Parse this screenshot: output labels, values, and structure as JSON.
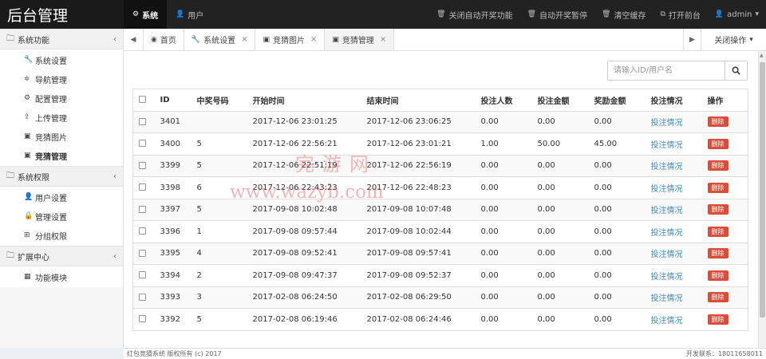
{
  "brand": "后台管理",
  "topnav": {
    "items": [
      {
        "label": "系统",
        "icon": "gear-icon"
      },
      {
        "label": "用户",
        "icon": "user-icon"
      }
    ],
    "right": [
      {
        "label": "关闭自动开奖功能",
        "icon": "trash-icon"
      },
      {
        "label": "自动开奖暂停",
        "icon": "trash-icon"
      },
      {
        "label": "清空缓存",
        "icon": "trash-icon"
      },
      {
        "label": "打开前台",
        "icon": "external-link-icon"
      },
      {
        "label": "admin",
        "icon": "user-icon"
      }
    ]
  },
  "sidebar": {
    "groups": [
      {
        "label": "系统功能",
        "items": [
          "系统设置",
          "导航管理",
          "配置管理",
          "上传管理",
          "竞猜图片",
          "竞猜管理"
        ]
      },
      {
        "label": "系统权限",
        "items": [
          "用户设置",
          "管理设置",
          "分组权限"
        ]
      },
      {
        "label": "扩展中心",
        "items": [
          "功能模块"
        ]
      }
    ]
  },
  "tabs": {
    "items": [
      "首页",
      "系统设置",
      "竞猜图片",
      "竞猜管理"
    ],
    "close_ops": "关闭操作"
  },
  "search": {
    "placeholder": "请输入ID/用户名"
  },
  "table": {
    "headers": [
      "ID",
      "中奖号码",
      "开始时间",
      "结束时间",
      "投注人数",
      "投注金额",
      "奖励金额",
      "投注情况",
      "操作"
    ],
    "link_label": "投注情况",
    "delete_label": "删除",
    "rows": [
      [
        "3401",
        "",
        "2017-12-06 23:01:25",
        "2017-12-06 23:06:25",
        "0.00",
        "0.00",
        "0.00"
      ],
      [
        "3400",
        "5",
        "2017-12-06 22:56:21",
        "2017-12-06 23:01:21",
        "1.00",
        "50.00",
        "45.00"
      ],
      [
        "3399",
        "5",
        "2017-12-06 22:51:19",
        "2017-12-06 22:56:19",
        "0.00",
        "0.00",
        "0.00"
      ],
      [
        "3398",
        "6",
        "2017-12-06 22:43:23",
        "2017-12-06 22:48:23",
        "0.00",
        "0.00",
        "0.00"
      ],
      [
        "3397",
        "5",
        "2017-09-08 10:02:48",
        "2017-09-08 10:07:48",
        "0.00",
        "0.00",
        "0.00"
      ],
      [
        "3396",
        "1",
        "2017-09-08 09:57:44",
        "2017-09-08 10:02:44",
        "0.00",
        "0.00",
        "0.00"
      ],
      [
        "3395",
        "4",
        "2017-09-08 09:52:41",
        "2017-09-08 09:57:41",
        "0.00",
        "0.00",
        "0.00"
      ],
      [
        "3394",
        "2",
        "2017-09-08 09:47:37",
        "2017-09-08 09:52:37",
        "0.00",
        "0.00",
        "0.00"
      ],
      [
        "3393",
        "3",
        "2017-02-08 06:24:50",
        "2017-02-08 06:29:50",
        "0.00",
        "0.00",
        "0.00"
      ],
      [
        "3392",
        "5",
        "2017-02-08 06:19:46",
        "2017-02-08 06:24:46",
        "0.00",
        "0.00",
        "0.00"
      ]
    ]
  },
  "watermark": {
    "line1": "完游网",
    "line2": "www.wazyb.com"
  },
  "footer": {
    "left": "红包竞猜系统 版权所有 (c) 2017",
    "right": "开发联系：18011658011"
  }
}
